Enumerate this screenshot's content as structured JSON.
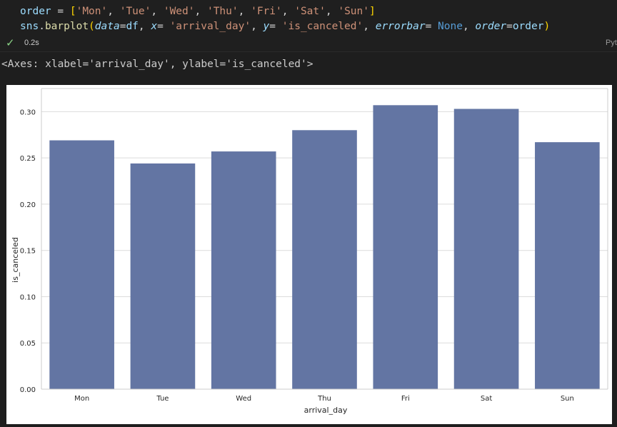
{
  "code": {
    "line1": {
      "var": "order",
      "eq": " = ",
      "open": "[",
      "items": [
        "'Mon'",
        "'Tue'",
        "'Wed'",
        "'Thu'",
        "'Fri'",
        "'Sat'",
        "'Sun'"
      ],
      "sep": ", ",
      "close": "]"
    },
    "line2": {
      "obj": "sns",
      "dot": ".",
      "fn": "barplot",
      "paren_open": "(",
      "kw_data": "data",
      "eq_data": "=",
      "val_data": "df",
      "sep": ", ",
      "kw_x": "x",
      "eq_x": "= ",
      "val_x": "'arrival_day'",
      "kw_y": "y",
      "eq_y": "= ",
      "val_y": "'is_canceled'",
      "kw_err": "errorbar",
      "eq_err": "= ",
      "val_err": "None",
      "kw_order": "order",
      "eq_order": "=",
      "val_order": "order",
      "paren_close": ")"
    }
  },
  "status": {
    "check": "✓",
    "time": "0.2s",
    "kernel": "Pyt"
  },
  "output_text": "<Axes: xlabel='arrival_day', ylabel='is_canceled'>",
  "colors": {
    "bar": "#6375a3",
    "background": "#1e1e1e",
    "plot_bg": "#ffffff",
    "grid": "#dcdcdc"
  },
  "chart_data": {
    "type": "bar",
    "categories": [
      "Mon",
      "Tue",
      "Wed",
      "Thu",
      "Fri",
      "Sat",
      "Sun"
    ],
    "values": [
      0.269,
      0.244,
      0.257,
      0.28,
      0.307,
      0.303,
      0.267
    ],
    "xlabel": "arrival_day",
    "ylabel": "is_canceled",
    "ylim": [
      0,
      0.325
    ],
    "yticks": [
      "0.00",
      "0.05",
      "0.10",
      "0.15",
      "0.20",
      "0.25",
      "0.30"
    ],
    "grid": "horizontal"
  }
}
